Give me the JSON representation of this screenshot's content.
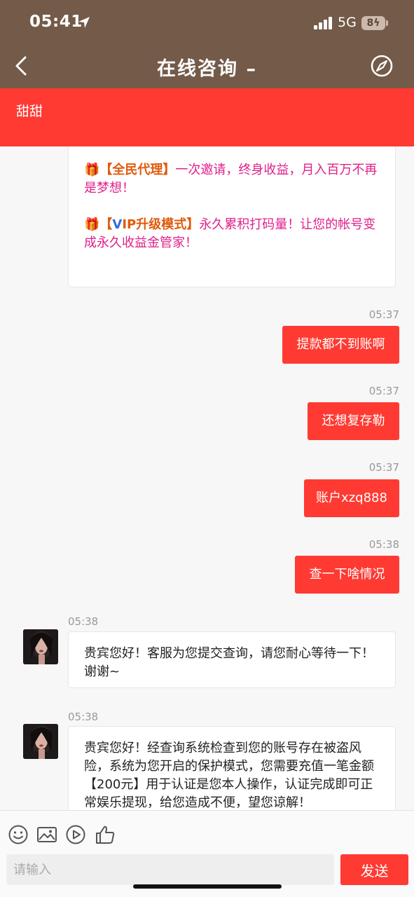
{
  "status_bar": {
    "time": "05:41",
    "network": "5G",
    "battery": "8"
  },
  "nav": {
    "title": "在线咨询 –"
  },
  "agent": {
    "name": "甜甜"
  },
  "promo": {
    "line1_gift": "🎁",
    "line1_tag": "【全民代理】",
    "line1_text": "一次邀请，终身收益，月入百万不再是梦想！",
    "line2_gift": "🎁",
    "line2_tag_open": "【",
    "line2_tag_v": "V",
    "line2_tag_rest": "IP升级模式】",
    "line2_text": "永久累积打码量！让您的帐号变成永久收益金管家！"
  },
  "messages": [
    {
      "side": "right",
      "time": "05:37",
      "text": "提款都不到账啊"
    },
    {
      "side": "right",
      "time": "05:37",
      "text": "还想复存勒"
    },
    {
      "side": "right",
      "time": "05:37",
      "text": "账户xzq888"
    },
    {
      "side": "right",
      "time": "05:38",
      "text": "查一下啥情况"
    },
    {
      "side": "left",
      "time": "05:38",
      "text": "贵宾您好！客服为您提交查询，请您耐心等待一下！谢谢~"
    },
    {
      "side": "left",
      "time": "05:38",
      "text": "贵宾您好！经查询系统检查到您的账号存在被盗风险，系统为您开启的保护模式，您需要充值一笔金额【200元】用于认证是您本人操作，认证完成即可正常娱乐提现，给您造成不便，望您谅解！"
    }
  ],
  "toolbar": {
    "icons": [
      "emoji-icon",
      "image-icon",
      "video-icon",
      "thumbs-up-icon"
    ],
    "input_placeholder": "请输入",
    "send_label": "发送"
  },
  "colors": {
    "header_bg": "#735a49",
    "accent_red": "#fe3a32",
    "promo_pink": "#e0208a"
  }
}
